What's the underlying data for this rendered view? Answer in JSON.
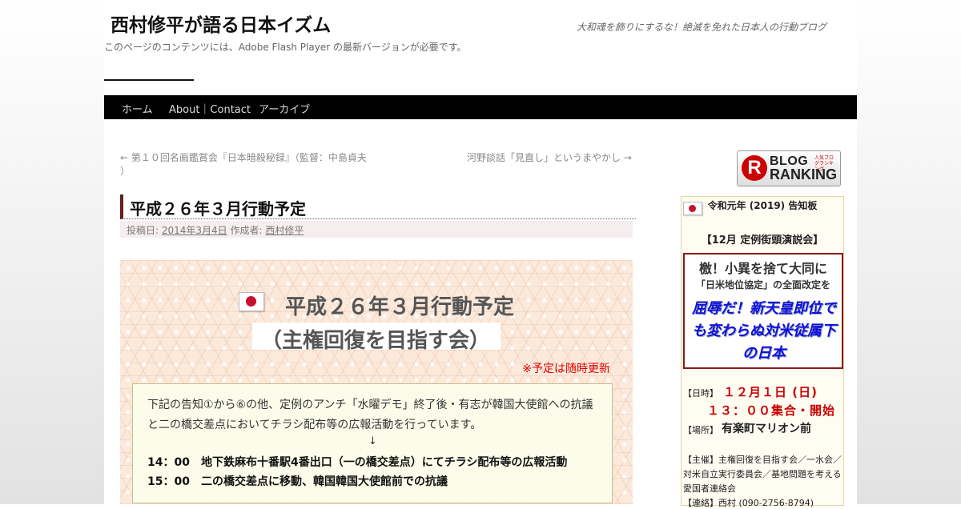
{
  "header": {
    "site_title": "西村修平が語る日本イズム",
    "site_description": "大和魂を飾りにするな！絶滅を免れた日本人の行動ブログ",
    "flash_notice": "このページのコンテンツには、Adobe Flash Player の最新バージョンが必要です。"
  },
  "nav": {
    "items": [
      {
        "label": "ホーム"
      },
      {
        "label": "About｜Contact"
      },
      {
        "label": "アーカイブ"
      }
    ]
  },
  "post_nav": {
    "prev_line1": "← 第１０回名画鑑賞会『日本暗殺秘録』（監督：中島貞夫",
    "prev_line2": "）",
    "next": "河野談話「見直し」というまやかし →"
  },
  "post": {
    "title": "平成２６年３月行動予定",
    "meta_posted_label": "投稿日:",
    "meta_date": "2014年3月4日",
    "meta_author_label": "作成者:",
    "meta_author": "西村修平",
    "banner_title": "平成２６年３月行動予定",
    "banner_subtitle": "（主権回復を目指す会）",
    "update_note": "※予定は随時更新",
    "notice_text": "下記の告知①から⑥の他、定例のアンチ「水曜デモ」終了後・有志が韓国大使館への抗議と二の橋交差点においてチラシ配布等の広報活動を行っています。",
    "arrow": "↓",
    "schedule": [
      "14：00　地下鉄麻布十番駅4番出口（一の橋交差点）にてチラシ配布等の広報活動",
      "15：00　二の橋交差点に移動、韓国韓国大使館前での抗議"
    ]
  },
  "sidebar": {
    "ranking": {
      "logo_letter": "R",
      "word1": "BLOG",
      "word2": "RANKING",
      "tiny": "人気ブログランキング"
    },
    "notice_title": "令和元年 (2019) 告知板",
    "event_title": "【12月 定例街頭演説会】",
    "geki": "檄！小異を捨て大同に",
    "kaitei": "「日米地位協定」の全面改定を",
    "blue_text": "屈辱だ！新天皇即位でも変わらぬ対米従属下の日本",
    "date_label": "【日時】",
    "date_value": "１２月１日 (日)",
    "time_value": "１３：００集合・開始",
    "place_label": "【場所】",
    "place_value": "有楽町マリオン前",
    "host": "【主催】主権回復を目指す会／一水会／対米自立実行委員会／基地問題を考える愛国者連絡会",
    "contact": "【連絡】西村 (090-2756-8794)"
  },
  "colors": {
    "nav_bg": "#000000",
    "title_bar": "#6b1c1c",
    "red_note": "#e00000",
    "blue_text": "#1010dd"
  }
}
